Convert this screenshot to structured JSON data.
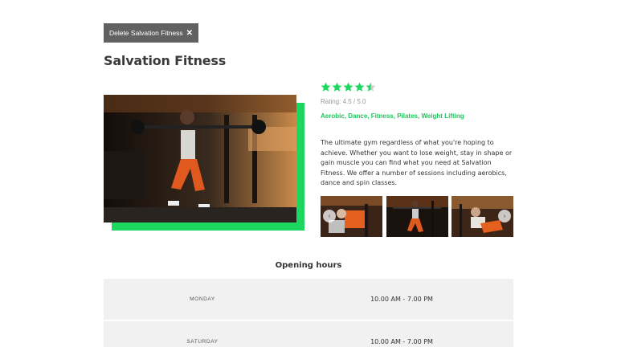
{
  "delete_button": {
    "label": "Delete Salvation Fitness",
    "icon": "close-icon"
  },
  "title": "Salvation Fitness",
  "accent_color": "#1ed760",
  "rating": {
    "value": 4.5,
    "max": 5,
    "text": "Rating: 4.5 / 5.0",
    "icon": "star-icon"
  },
  "tags": [
    "Aerobic",
    "Dance",
    "Fitness",
    "Pilates",
    "Weight Lifting"
  ],
  "description": "The ultimate gym regardless of what you're hoping to achieve. Whether you want to lose weight, stay in shape or gain muscle you can find what you need at Salvation Fitness. We offer a number of sessions including aerobics, dance and spin classes.",
  "gallery": {
    "prev_icon": "chevron-left-icon",
    "next_icon": "chevron-right-icon",
    "prev_glyph": "‹",
    "next_glyph": "›"
  },
  "hours": {
    "title": "Opening hours",
    "rows": [
      {
        "day": "MONDAY",
        "time": "10.00 AM - 7.00 PM"
      },
      {
        "day": "SATURDAY",
        "time": "10.00 AM - 7.00 PM"
      }
    ]
  }
}
